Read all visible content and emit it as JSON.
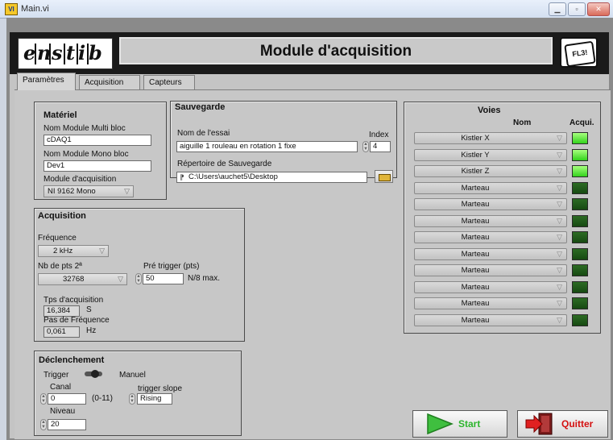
{
  "window": {
    "title": "Main.vi",
    "icon_name": "labview-vi-icon"
  },
  "header": {
    "logo": [
      "e",
      "n",
      "s",
      "t",
      "i",
      "b"
    ],
    "title": "Module d'acquisition",
    "badge": "FL3!"
  },
  "tabs": [
    {
      "label": "Paramètres",
      "active": true
    },
    {
      "label": "Acquisition"
    },
    {
      "label": "Capteurs"
    }
  ],
  "materiel": {
    "title": "Matériel",
    "multi_label": "Nom Module Multi bloc",
    "multi_value": "cDAQ1",
    "mono_label": "Nom Module Mono bloc",
    "mono_value": "Dev1",
    "module_label": "Module d'acquisition",
    "module_value": "NI 9162 Mono"
  },
  "sauvegarde": {
    "title": "Sauvegarde",
    "essai_label": "Nom de l'essai",
    "essai_value": "aiguille 1 rouleau en rotation 1 fixe",
    "index_label": "Index",
    "index_value": "4",
    "repertoire_label": "Répertoire de Sauvegarde",
    "repertoire_value": "C:\\Users\\auchet5\\Desktop"
  },
  "acquisition": {
    "title": "Acquisition",
    "freq_label": "Fréquence",
    "freq_value": "2 kHz",
    "nbpts_label": "Nb de pts 2ª",
    "nbpts_value": "32768",
    "pretrig_label": "Pré trigger (pts)",
    "pretrig_value": "50",
    "pretrig_unit": "N/8 max.",
    "tps_label": "Tps d'acquisition",
    "tps_value": "16,384",
    "tps_unit": "S",
    "pas_label": "Pas de Fréquence",
    "pas_value": "0,061",
    "pas_unit": "Hz"
  },
  "declenchement": {
    "title": "Déclenchement",
    "trigger_label": "Trigger",
    "manuel_label": "Manuel",
    "canal_label": "Canal",
    "canal_value": "0",
    "canal_range": "(0-11)",
    "slope_label": "trigger slope",
    "slope_value": "Rising",
    "niveau_label": "Niveau",
    "niveau_value": "20"
  },
  "voies": {
    "title": "Voies",
    "col_nom": "Nom",
    "col_acqui": "Acqui.",
    "rows": [
      {
        "name": "Kistler X",
        "acqui": true
      },
      {
        "name": "Kistler Y",
        "acqui": true
      },
      {
        "name": "Kistler Z",
        "acqui": true
      },
      {
        "name": "Marteau",
        "acqui": false
      },
      {
        "name": "Marteau",
        "acqui": false
      },
      {
        "name": "Marteau",
        "acqui": false
      },
      {
        "name": "Marteau",
        "acqui": false
      },
      {
        "name": "Marteau",
        "acqui": false
      },
      {
        "name": "Marteau",
        "acqui": false
      },
      {
        "name": "Marteau",
        "acqui": false
      },
      {
        "name": "Marteau",
        "acqui": false
      },
      {
        "name": "Marteau",
        "acqui": false
      }
    ]
  },
  "buttons": {
    "start": "Start",
    "quit": "Quitter"
  },
  "colors": {
    "led_on": "#33d21c",
    "led_off": "#174a12",
    "start_text": "#2db52d",
    "quit_text": "#d41010"
  }
}
